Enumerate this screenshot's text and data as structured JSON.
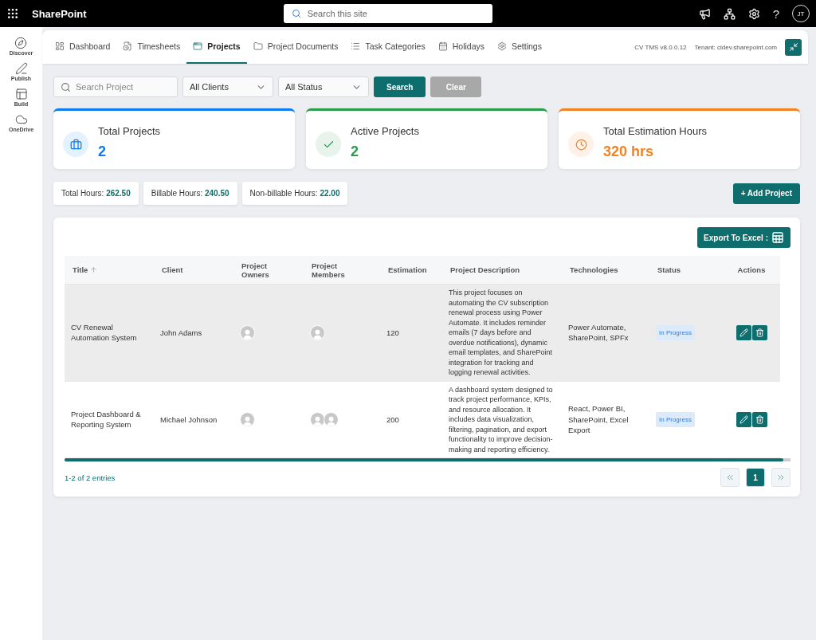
{
  "topbar": {
    "app_name": "SharePoint",
    "search_placeholder": "Search this site",
    "help": "?",
    "avatar_initials": "JT"
  },
  "rail": {
    "items": [
      {
        "label": "Discover"
      },
      {
        "label": "Publish"
      },
      {
        "label": "Build"
      },
      {
        "label": "OneDrive"
      }
    ]
  },
  "nav": {
    "tabs": [
      {
        "label": "Dashboard",
        "selected": false
      },
      {
        "label": "Timesheets",
        "selected": false
      },
      {
        "label": "Projects",
        "selected": true
      },
      {
        "label": "Project Documents",
        "selected": false
      },
      {
        "label": "Task Categories",
        "selected": false
      },
      {
        "label": "Holidays",
        "selected": false
      },
      {
        "label": "Settings",
        "selected": false
      }
    ],
    "version": "CV TMS v8.0.0.12",
    "tenant": "Tenant: cidev.sharepoint.com"
  },
  "filters": {
    "search_placeholder": "Search Project",
    "client_select": "All Clients",
    "status_select": "All Status",
    "search_button": "Search",
    "clear_button": "Clear",
    "clear_disabled": true
  },
  "stats": [
    {
      "kind": "briefcase",
      "title": "Total Projects",
      "value": "2",
      "color": "#0d7cf2"
    },
    {
      "kind": "check",
      "title": "Active Projects",
      "value": "2",
      "color": "#2a9d48"
    },
    {
      "kind": "clock",
      "title": "Total Estimation Hours",
      "value": "320 hrs",
      "color": "#f58220"
    }
  ],
  "hours": [
    {
      "label": "Total Hours:",
      "value": "262.50"
    },
    {
      "label": "Billable Hours:",
      "value": "240.50"
    },
    {
      "label": "Non-billable Hours:",
      "value": "22.00"
    }
  ],
  "add_button": "+ Add Project",
  "export_button": "Export To Excel :",
  "table": {
    "columns": [
      {
        "label": "Title",
        "sorted": true
      },
      {
        "label": "Client",
        "sorted": false
      },
      {
        "label": "Project Owners",
        "sorted": false
      },
      {
        "label": "Project Members",
        "sorted": false
      },
      {
        "label": "Estimation",
        "sorted": false
      },
      {
        "label": "Project Description",
        "sorted": false
      },
      {
        "label": "Technologies",
        "sorted": false
      },
      {
        "label": "Status",
        "sorted": false
      },
      {
        "label": "Actions",
        "sorted": false
      }
    ],
    "rows": [
      {
        "title": "CV Renewal Automation System",
        "client": "John Adams",
        "owners": [
          {
            "kind": "avatar"
          }
        ],
        "members": [
          {
            "kind": "avatar"
          }
        ],
        "estimation": "120",
        "description": "This project focuses on automating the CV subscription renewal process using Power Automate. It includes reminder emails (7 days before and overdue notifications), dynamic email templates, and SharePoint integration for tracking and logging renewal activities.",
        "technologies": "Power Automate, SharePoint, SPFx",
        "status": "In Progress",
        "highlighted": true
      },
      {
        "title": "Project Dashboard & Reporting System",
        "client": "Michael Johnson",
        "owners": [
          {
            "kind": "avatar"
          }
        ],
        "members": [
          {
            "kind": "avatar"
          },
          {
            "kind": "avatar"
          }
        ],
        "estimation": "200",
        "description": "A dashboard system designed to track project performance, KPIs, and resource allocation. It includes data visualization, filtering, pagination, and export functionality to improve decision-making and reporting efficiency.",
        "technologies": "React, Power BI, SharePoint, Excel Export",
        "status": "In Progress",
        "highlighted": false
      }
    ]
  },
  "footer": {
    "summary": "1-2 of 2 entries",
    "pages": [
      {
        "label": "1",
        "selected": true
      }
    ]
  }
}
